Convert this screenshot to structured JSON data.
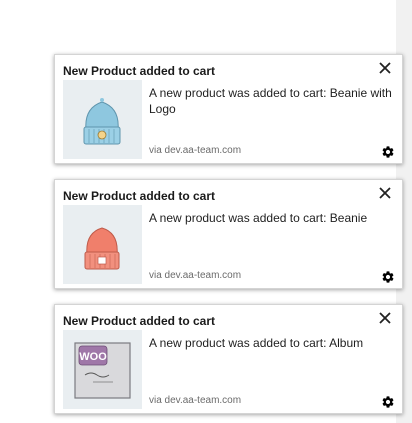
{
  "notifications": [
    {
      "title": "New Product added to cart",
      "message": "A new product was added to cart: Beanie with Logo",
      "source": "via dev.aa-team.com",
      "image": "beanie-with-logo-thumbnail",
      "image_color": "#8ec7df"
    },
    {
      "title": "New Product added to cart",
      "message": "A new product was added to cart: Beanie",
      "source": "via dev.aa-team.com",
      "image": "beanie-thumbnail",
      "image_color": "#f07f6b"
    },
    {
      "title": "New Product added to cart",
      "message": "A new product was added to cart: Album",
      "source": "via dev.aa-team.com",
      "image": "album-thumbnail",
      "image_color": "#9f77a8",
      "image_text": "WOO"
    }
  ],
  "icons": {
    "close": "close-icon",
    "settings": "gear-icon"
  }
}
